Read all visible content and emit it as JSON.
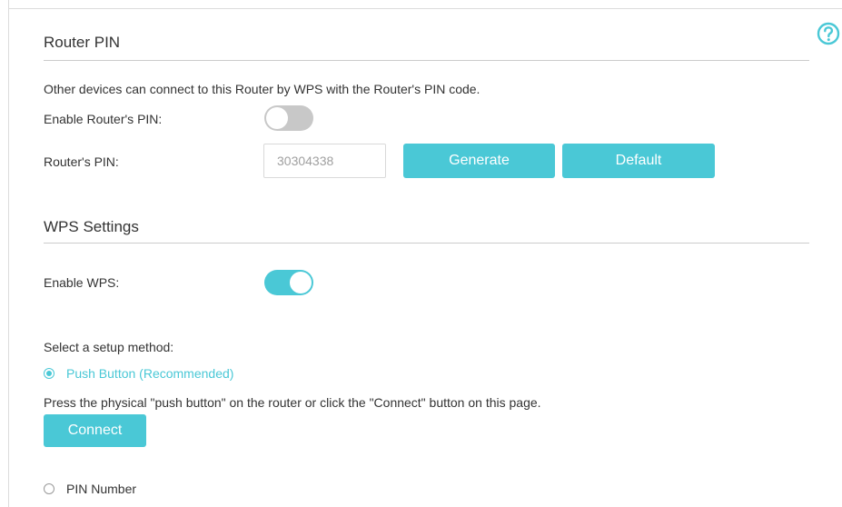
{
  "colors": {
    "accent": "#4ac8d6",
    "toggle_off": "#c8c8c8",
    "text": "#333333"
  },
  "help": {
    "icon": "question-circle-icon"
  },
  "router_pin": {
    "title": "Router PIN",
    "description": "Other devices can connect to this Router by WPS with the Router's PIN code.",
    "enable_label": "Enable Router's PIN:",
    "enable_state": "off",
    "pin_label": "Router's PIN:",
    "pin_value": "30304338",
    "generate_label": "Generate",
    "default_label": "Default"
  },
  "wps": {
    "title": "WPS Settings",
    "enable_label": "Enable WPS:",
    "enable_state": "on",
    "method_label": "Select a setup method:",
    "push_button_label": "Push Button (Recommended)",
    "push_button_selected": true,
    "push_description": "Press the physical \"push button\" on the router or click the \"Connect\" button on this page.",
    "connect_label": "Connect",
    "pin_number_label": "PIN Number",
    "pin_number_selected": false
  }
}
